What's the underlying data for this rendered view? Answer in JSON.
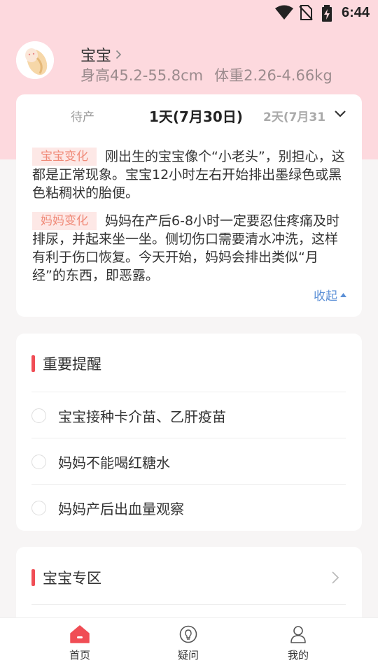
{
  "status_bar": {
    "time": "6:44"
  },
  "header": {
    "baby_name": "宝宝",
    "height_range": "身高45.2-55.8cm",
    "weight_range": "体重2.26-4.66kg"
  },
  "day_tabs": {
    "prev": "待产",
    "current": "1天(7月30日)",
    "next": "2天(7月31"
  },
  "changes": {
    "baby_badge": "宝宝变化",
    "baby_text": "刚出生的宝宝像个“小老头”，别担心，这都是正常现象。宝宝12小时左右开始排出墨绿色或黑色粘稠状的胎便。",
    "mom_badge": "妈妈变化",
    "mom_text": "妈妈在产后6-8小时一定要忍住疼痛及时排尿，并起来坐一坐。侧切伤口需要清水冲洗，这样有利于伤口恢复。今天开始，妈妈会排出类似“月经”的东西，即恶露。",
    "collapse_label": "收起"
  },
  "reminders": {
    "title": "重要提醒",
    "items": [
      "宝宝接种卡介苗、乙肝疫苗",
      "妈妈不能喝红糖水",
      "妈妈产后出血量观察"
    ]
  },
  "baby_zone": {
    "title": "宝宝专区"
  },
  "bottom_nav": {
    "home": "首页",
    "questions": "疑问",
    "mine": "我的"
  },
  "colors": {
    "header_bg": "#fdd9de",
    "accent_red": "#f04d55",
    "badge_bg": "#fde8e6",
    "badge_text": "#f08a78",
    "link_blue": "#5b8fd6"
  }
}
